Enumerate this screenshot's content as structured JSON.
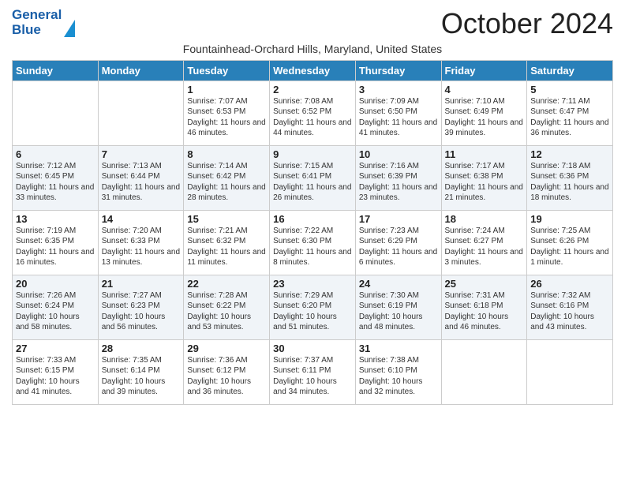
{
  "logo": {
    "line1": "General",
    "line2": "Blue"
  },
  "title": "October 2024",
  "subtitle": "Fountainhead-Orchard Hills, Maryland, United States",
  "days_of_week": [
    "Sunday",
    "Monday",
    "Tuesday",
    "Wednesday",
    "Thursday",
    "Friday",
    "Saturday"
  ],
  "weeks": [
    [
      {
        "day": "",
        "info": ""
      },
      {
        "day": "",
        "info": ""
      },
      {
        "day": "1",
        "info": "Sunrise: 7:07 AM\nSunset: 6:53 PM\nDaylight: 11 hours and 46 minutes."
      },
      {
        "day": "2",
        "info": "Sunrise: 7:08 AM\nSunset: 6:52 PM\nDaylight: 11 hours and 44 minutes."
      },
      {
        "day": "3",
        "info": "Sunrise: 7:09 AM\nSunset: 6:50 PM\nDaylight: 11 hours and 41 minutes."
      },
      {
        "day": "4",
        "info": "Sunrise: 7:10 AM\nSunset: 6:49 PM\nDaylight: 11 hours and 39 minutes."
      },
      {
        "day": "5",
        "info": "Sunrise: 7:11 AM\nSunset: 6:47 PM\nDaylight: 11 hours and 36 minutes."
      }
    ],
    [
      {
        "day": "6",
        "info": "Sunrise: 7:12 AM\nSunset: 6:45 PM\nDaylight: 11 hours and 33 minutes."
      },
      {
        "day": "7",
        "info": "Sunrise: 7:13 AM\nSunset: 6:44 PM\nDaylight: 11 hours and 31 minutes."
      },
      {
        "day": "8",
        "info": "Sunrise: 7:14 AM\nSunset: 6:42 PM\nDaylight: 11 hours and 28 minutes."
      },
      {
        "day": "9",
        "info": "Sunrise: 7:15 AM\nSunset: 6:41 PM\nDaylight: 11 hours and 26 minutes."
      },
      {
        "day": "10",
        "info": "Sunrise: 7:16 AM\nSunset: 6:39 PM\nDaylight: 11 hours and 23 minutes."
      },
      {
        "day": "11",
        "info": "Sunrise: 7:17 AM\nSunset: 6:38 PM\nDaylight: 11 hours and 21 minutes."
      },
      {
        "day": "12",
        "info": "Sunrise: 7:18 AM\nSunset: 6:36 PM\nDaylight: 11 hours and 18 minutes."
      }
    ],
    [
      {
        "day": "13",
        "info": "Sunrise: 7:19 AM\nSunset: 6:35 PM\nDaylight: 11 hours and 16 minutes."
      },
      {
        "day": "14",
        "info": "Sunrise: 7:20 AM\nSunset: 6:33 PM\nDaylight: 11 hours and 13 minutes."
      },
      {
        "day": "15",
        "info": "Sunrise: 7:21 AM\nSunset: 6:32 PM\nDaylight: 11 hours and 11 minutes."
      },
      {
        "day": "16",
        "info": "Sunrise: 7:22 AM\nSunset: 6:30 PM\nDaylight: 11 hours and 8 minutes."
      },
      {
        "day": "17",
        "info": "Sunrise: 7:23 AM\nSunset: 6:29 PM\nDaylight: 11 hours and 6 minutes."
      },
      {
        "day": "18",
        "info": "Sunrise: 7:24 AM\nSunset: 6:27 PM\nDaylight: 11 hours and 3 minutes."
      },
      {
        "day": "19",
        "info": "Sunrise: 7:25 AM\nSunset: 6:26 PM\nDaylight: 11 hours and 1 minute."
      }
    ],
    [
      {
        "day": "20",
        "info": "Sunrise: 7:26 AM\nSunset: 6:24 PM\nDaylight: 10 hours and 58 minutes."
      },
      {
        "day": "21",
        "info": "Sunrise: 7:27 AM\nSunset: 6:23 PM\nDaylight: 10 hours and 56 minutes."
      },
      {
        "day": "22",
        "info": "Sunrise: 7:28 AM\nSunset: 6:22 PM\nDaylight: 10 hours and 53 minutes."
      },
      {
        "day": "23",
        "info": "Sunrise: 7:29 AM\nSunset: 6:20 PM\nDaylight: 10 hours and 51 minutes."
      },
      {
        "day": "24",
        "info": "Sunrise: 7:30 AM\nSunset: 6:19 PM\nDaylight: 10 hours and 48 minutes."
      },
      {
        "day": "25",
        "info": "Sunrise: 7:31 AM\nSunset: 6:18 PM\nDaylight: 10 hours and 46 minutes."
      },
      {
        "day": "26",
        "info": "Sunrise: 7:32 AM\nSunset: 6:16 PM\nDaylight: 10 hours and 43 minutes."
      }
    ],
    [
      {
        "day": "27",
        "info": "Sunrise: 7:33 AM\nSunset: 6:15 PM\nDaylight: 10 hours and 41 minutes."
      },
      {
        "day": "28",
        "info": "Sunrise: 7:35 AM\nSunset: 6:14 PM\nDaylight: 10 hours and 39 minutes."
      },
      {
        "day": "29",
        "info": "Sunrise: 7:36 AM\nSunset: 6:12 PM\nDaylight: 10 hours and 36 minutes."
      },
      {
        "day": "30",
        "info": "Sunrise: 7:37 AM\nSunset: 6:11 PM\nDaylight: 10 hours and 34 minutes."
      },
      {
        "day": "31",
        "info": "Sunrise: 7:38 AM\nSunset: 6:10 PM\nDaylight: 10 hours and 32 minutes."
      },
      {
        "day": "",
        "info": ""
      },
      {
        "day": "",
        "info": ""
      }
    ]
  ]
}
